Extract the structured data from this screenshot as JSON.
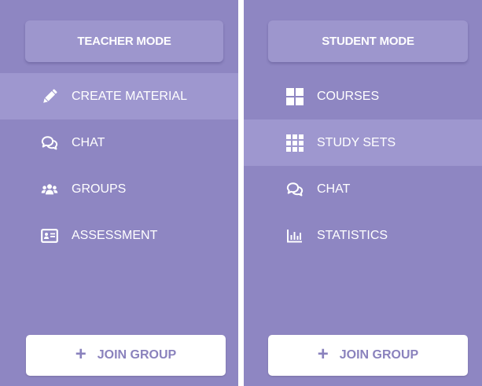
{
  "teacher_panel": {
    "mode_label": "TEACHER MODE",
    "items": [
      {
        "label": "CREATE MATERIAL",
        "icon": "pencil-icon",
        "active": true
      },
      {
        "label": "CHAT",
        "icon": "chat-bubbles-icon",
        "active": false
      },
      {
        "label": "GROUPS",
        "icon": "group-icon",
        "active": false
      },
      {
        "label": "ASSESSMENT",
        "icon": "id-card-icon",
        "active": false
      }
    ],
    "join_label": "JOIN GROUP"
  },
  "student_panel": {
    "mode_label": "STUDENT MODE",
    "items": [
      {
        "label": "COURSES",
        "icon": "grid-2x2-icon",
        "active": false
      },
      {
        "label": "STUDY SETS",
        "icon": "grid-3x3-icon",
        "active": true
      },
      {
        "label": "CHAT",
        "icon": "chat-bubbles-icon",
        "active": false
      },
      {
        "label": "STATISTICS",
        "icon": "bar-chart-icon",
        "active": false
      }
    ],
    "join_label": "JOIN GROUP"
  },
  "colors": {
    "panel_bg": "#8e86c2",
    "active_item_bg": "#9e97cf",
    "mode_button_bg": "#9d96cd",
    "join_text": "#8a82bd"
  }
}
